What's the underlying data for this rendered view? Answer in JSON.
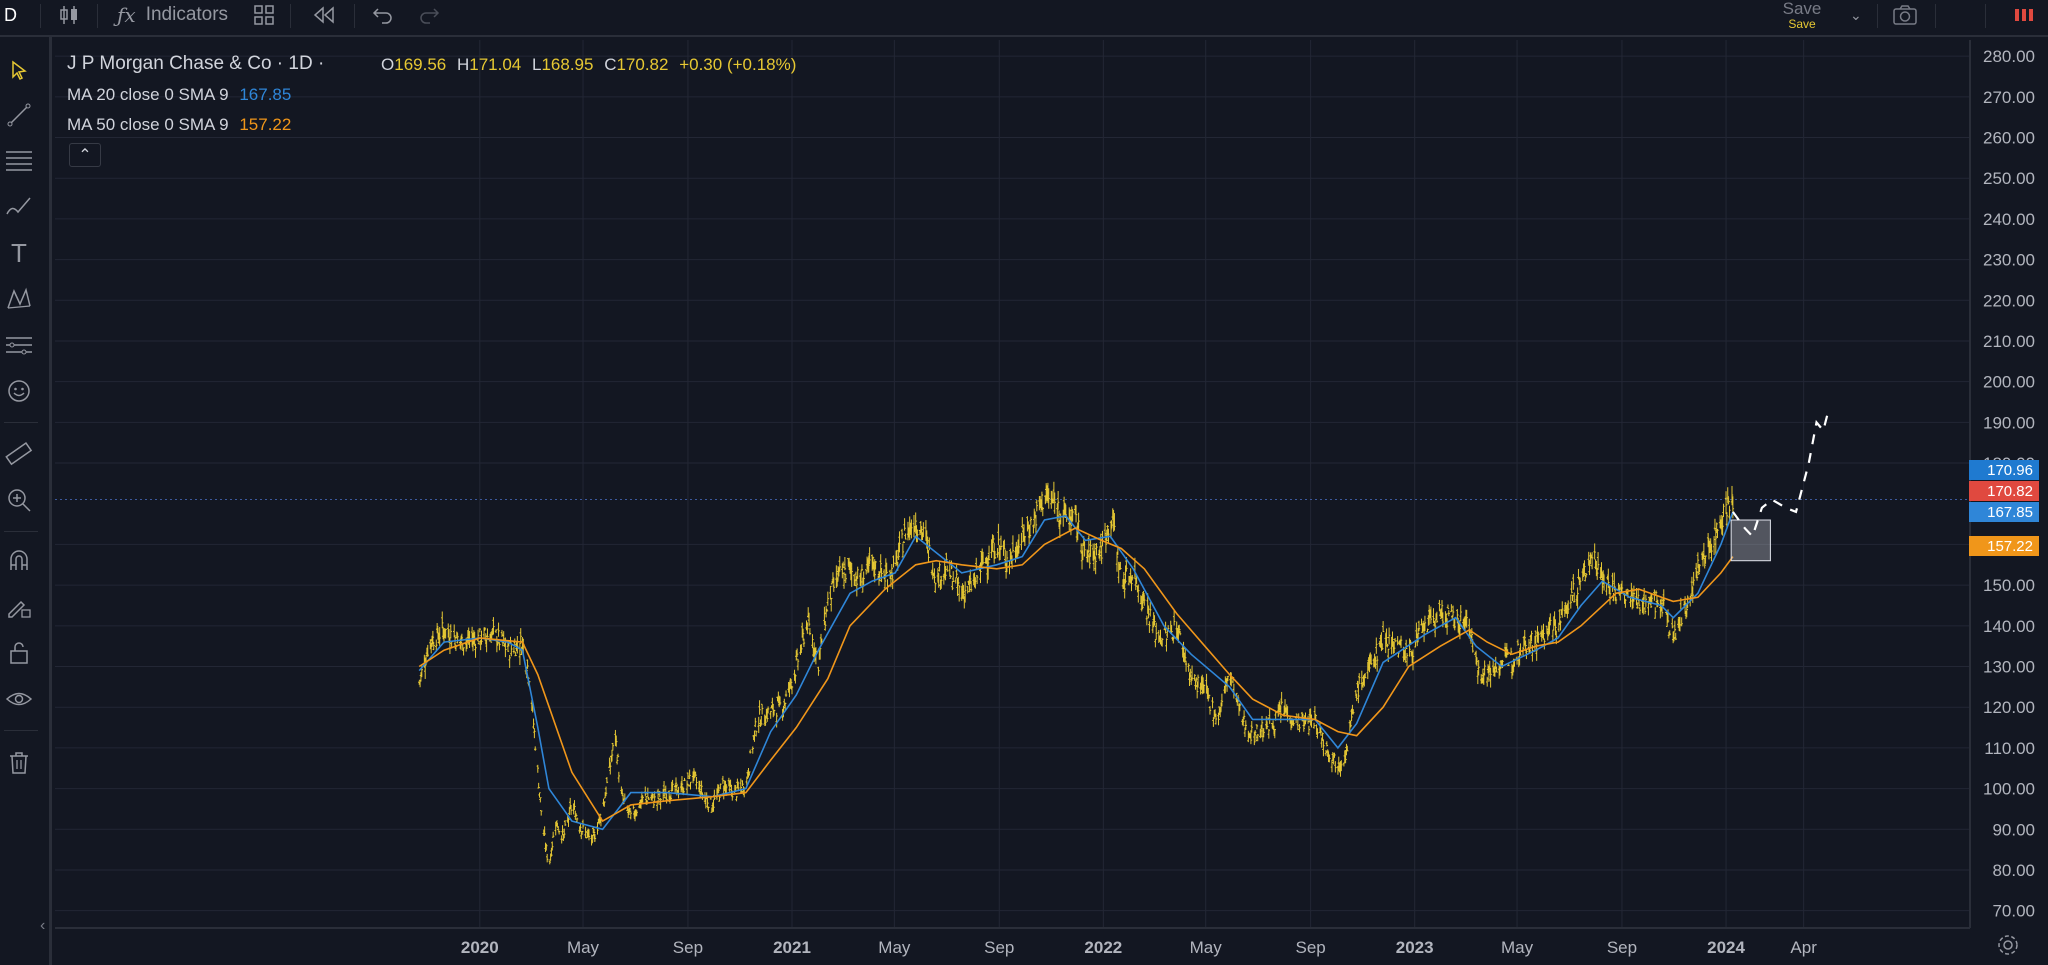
{
  "toolbar": {
    "symbol_letter": "D",
    "indicators_label": "Indicators",
    "save_label": "Save",
    "save_sublabel": "Save"
  },
  "legend": {
    "title": "J P Morgan Chase & Co · 1D ·",
    "open_key": "O",
    "open": "169.56",
    "high_key": "H",
    "high": "171.04",
    "low_key": "L",
    "low": "168.95",
    "close_key": "C",
    "close": "170.82",
    "change": "+0.30 (+0.18%)",
    "ma1_label": "MA 20 close 0 SMA 9",
    "ma1_value": "167.85",
    "ma2_label": "MA 50 close 0 SMA 9",
    "ma2_value": "157.22",
    "collapse_glyph": "⌃"
  },
  "price_tags": {
    "high_tag": "170.96",
    "close_tag": "170.82",
    "ma1_tag": "167.85",
    "ma2_tag": "157.22"
  },
  "colors": {
    "background": "#131722",
    "candles": "#e6c833",
    "ma1": "#2f86d8",
    "ma2": "#f0961a",
    "close_tag": "#e0493f",
    "high_tag": "#1f7ad0"
  },
  "chart_data": {
    "type": "line",
    "title": "J P Morgan Chase & Co · 1D ·",
    "xlabel": "",
    "ylabel": "",
    "ylim": [
      65,
      282
    ],
    "y_ticks": [
      "280.00",
      "270.00",
      "260.00",
      "250.00",
      "240.00",
      "230.00",
      "220.00",
      "210.00",
      "200.00",
      "190.00",
      "180.00",
      "160.00",
      "150.00",
      "140.00",
      "130.00",
      "120.00",
      "110.00",
      "100.00",
      "90.00",
      "80.00",
      "70.00"
    ],
    "x_ticks": [
      {
        "label": "2020",
        "date": "2020-01-01",
        "bold": true
      },
      {
        "label": "May",
        "date": "2020-05-01",
        "bold": false
      },
      {
        "label": "Sep",
        "date": "2020-09-01",
        "bold": false
      },
      {
        "label": "2021",
        "date": "2021-01-01",
        "bold": true
      },
      {
        "label": "May",
        "date": "2021-05-01",
        "bold": false
      },
      {
        "label": "Sep",
        "date": "2021-09-01",
        "bold": false
      },
      {
        "label": "2022",
        "date": "2022-01-01",
        "bold": true
      },
      {
        "label": "May",
        "date": "2022-05-01",
        "bold": false
      },
      {
        "label": "Sep",
        "date": "2022-09-01",
        "bold": false
      },
      {
        "label": "2023",
        "date": "2023-01-01",
        "bold": true
      },
      {
        "label": "May",
        "date": "2023-05-01",
        "bold": false
      },
      {
        "label": "Sep",
        "date": "2023-09-01",
        "bold": false
      },
      {
        "label": "2024",
        "date": "2024-01-01",
        "bold": true
      },
      {
        "label": "Apr",
        "date": "2024-04-01",
        "bold": false
      }
    ],
    "x_range": [
      "2018-08-21",
      "2024-10-13"
    ],
    "series": [
      {
        "name": "Price",
        "kind": "candles",
        "points": [
          [
            "2019-10-22",
            126
          ],
          [
            "2019-11-03",
            136
          ],
          [
            "2019-11-20",
            139
          ],
          [
            "2019-12-11",
            136
          ],
          [
            "2020-01-01",
            137
          ],
          [
            "2020-01-18",
            138
          ],
          [
            "2020-02-03",
            134
          ],
          [
            "2020-02-20",
            136
          ],
          [
            "2020-02-28",
            128
          ],
          [
            "2020-03-09",
            104
          ],
          [
            "2020-03-15",
            90
          ],
          [
            "2020-03-22",
            81
          ],
          [
            "2020-03-30",
            92
          ],
          [
            "2020-04-08",
            88
          ],
          [
            "2020-04-18",
            96
          ],
          [
            "2020-04-30",
            90
          ],
          [
            "2020-05-12",
            87
          ],
          [
            "2020-05-24",
            95
          ],
          [
            "2020-06-08",
            113
          ],
          [
            "2020-06-15",
            98
          ],
          [
            "2020-06-26",
            93
          ],
          [
            "2020-07-13",
            98
          ],
          [
            "2020-07-26",
            97
          ],
          [
            "2020-08-07",
            99
          ],
          [
            "2020-08-25",
            100
          ],
          [
            "2020-09-07",
            103
          ],
          [
            "2020-09-20",
            98
          ],
          [
            "2020-09-30",
            96
          ],
          [
            "2020-10-12",
            101
          ],
          [
            "2020-10-26",
            99
          ],
          [
            "2020-11-08",
            101
          ],
          [
            "2020-11-21",
            117
          ],
          [
            "2020-12-07",
            119
          ],
          [
            "2020-12-23",
            121
          ],
          [
            "2021-01-06",
            130
          ],
          [
            "2021-01-19",
            141
          ],
          [
            "2021-02-01",
            131
          ],
          [
            "2021-02-12",
            146
          ],
          [
            "2021-02-24",
            152
          ],
          [
            "2021-03-10",
            154
          ],
          [
            "2021-03-21",
            151
          ],
          [
            "2021-04-05",
            155
          ],
          [
            "2021-04-20",
            152
          ],
          [
            "2021-05-02",
            154
          ],
          [
            "2021-05-14",
            163
          ],
          [
            "2021-05-26",
            166
          ],
          [
            "2021-06-07",
            161
          ],
          [
            "2021-06-19",
            152
          ],
          [
            "2021-07-02",
            154
          ],
          [
            "2021-07-19",
            148
          ],
          [
            "2021-08-01",
            150
          ],
          [
            "2021-08-14",
            156
          ],
          [
            "2021-08-29",
            160
          ],
          [
            "2021-09-13",
            156
          ],
          [
            "2021-09-28",
            162
          ],
          [
            "2021-10-12",
            166
          ],
          [
            "2021-10-24",
            172
          ],
          [
            "2021-11-05",
            170
          ],
          [
            "2021-11-18",
            167
          ],
          [
            "2021-11-29",
            166
          ],
          [
            "2021-12-11",
            157
          ],
          [
            "2021-12-30",
            159
          ],
          [
            "2022-01-09",
            166
          ],
          [
            "2022-01-13",
            165
          ],
          [
            "2022-01-22",
            151
          ],
          [
            "2022-02-05",
            153
          ],
          [
            "2022-02-18",
            146
          ],
          [
            "2022-03-04",
            138
          ],
          [
            "2022-03-13",
            137
          ],
          [
            "2022-03-28",
            140
          ],
          [
            "2022-04-14",
            127
          ],
          [
            "2022-04-30",
            124
          ],
          [
            "2022-05-15",
            117
          ],
          [
            "2022-05-29",
            129
          ],
          [
            "2022-06-12",
            117
          ],
          [
            "2022-06-25",
            113
          ],
          [
            "2022-07-08",
            115
          ],
          [
            "2022-07-20",
            116
          ],
          [
            "2022-07-31",
            120
          ],
          [
            "2022-08-11",
            117
          ],
          [
            "2022-08-25",
            116
          ],
          [
            "2022-09-06",
            117
          ],
          [
            "2022-09-20",
            110
          ],
          [
            "2022-10-03",
            106
          ],
          [
            "2022-10-13",
            109
          ],
          [
            "2022-10-25",
            124
          ],
          [
            "2022-11-10",
            130
          ],
          [
            "2022-11-25",
            137
          ],
          [
            "2022-12-08",
            136
          ],
          [
            "2022-12-25",
            133
          ],
          [
            "2023-01-14",
            140
          ],
          [
            "2023-01-31",
            143
          ],
          [
            "2023-02-18",
            141
          ],
          [
            "2023-03-06",
            141
          ],
          [
            "2023-03-14",
            130
          ],
          [
            "2023-03-27",
            128
          ],
          [
            "2023-04-13",
            131
          ],
          [
            "2023-04-25",
            132
          ],
          [
            "2023-05-09",
            136
          ],
          [
            "2023-05-23",
            136
          ],
          [
            "2023-06-07",
            139
          ],
          [
            "2023-06-18",
            140
          ],
          [
            "2023-07-01",
            146
          ],
          [
            "2023-07-15",
            151
          ],
          [
            "2023-07-29",
            158
          ],
          [
            "2023-08-09",
            152
          ],
          [
            "2023-08-25",
            148
          ],
          [
            "2023-09-10",
            147
          ],
          [
            "2023-09-21",
            146
          ],
          [
            "2023-10-03",
            146
          ],
          [
            "2023-10-17",
            146
          ],
          [
            "2023-10-31",
            137
          ],
          [
            "2023-11-15",
            145
          ],
          [
            "2023-11-29",
            154
          ],
          [
            "2023-12-14",
            160
          ],
          [
            "2023-12-26",
            166
          ],
          [
            "2024-01-05",
            171
          ],
          [
            "2024-01-09",
            169
          ]
        ]
      },
      {
        "name": "MA 20 close 0 SMA 9",
        "kind": "line",
        "points": [
          [
            "2019-10-22",
            129
          ],
          [
            "2019-11-20",
            136
          ],
          [
            "2020-01-01",
            137
          ],
          [
            "2020-02-03",
            136
          ],
          [
            "2020-02-20",
            134
          ],
          [
            "2020-03-09",
            115
          ],
          [
            "2020-03-22",
            100
          ],
          [
            "2020-04-18",
            92
          ],
          [
            "2020-05-24",
            90
          ],
          [
            "2020-06-26",
            99
          ],
          [
            "2020-08-07",
            99
          ],
          [
            "2020-09-30",
            98
          ],
          [
            "2020-11-08",
            100
          ],
          [
            "2020-12-07",
            114
          ],
          [
            "2021-01-06",
            123
          ],
          [
            "2021-02-01",
            134
          ],
          [
            "2021-03-10",
            148
          ],
          [
            "2021-04-05",
            151
          ],
          [
            "2021-05-02",
            153
          ],
          [
            "2021-05-26",
            162
          ],
          [
            "2021-06-19",
            158
          ],
          [
            "2021-07-19",
            153
          ],
          [
            "2021-08-29",
            155
          ],
          [
            "2021-09-28",
            157
          ],
          [
            "2021-10-24",
            166
          ],
          [
            "2021-11-18",
            167
          ],
          [
            "2021-12-11",
            161
          ],
          [
            "2022-01-09",
            162
          ],
          [
            "2022-02-05",
            154
          ],
          [
            "2022-03-13",
            140
          ],
          [
            "2022-04-14",
            133
          ],
          [
            "2022-05-29",
            125
          ],
          [
            "2022-06-25",
            117
          ],
          [
            "2022-07-31",
            117
          ],
          [
            "2022-09-06",
            117
          ],
          [
            "2022-10-03",
            110
          ],
          [
            "2022-10-25",
            116
          ],
          [
            "2022-11-25",
            131
          ],
          [
            "2023-01-14",
            138
          ],
          [
            "2023-02-18",
            142
          ],
          [
            "2023-03-14",
            135
          ],
          [
            "2023-04-13",
            130
          ],
          [
            "2023-05-23",
            134
          ],
          [
            "2023-06-18",
            137
          ],
          [
            "2023-07-15",
            145
          ],
          [
            "2023-08-09",
            151
          ],
          [
            "2023-09-10",
            147
          ],
          [
            "2023-10-17",
            145
          ],
          [
            "2023-10-31",
            142
          ],
          [
            "2023-11-29",
            148
          ],
          [
            "2023-12-26",
            160
          ],
          [
            "2024-01-09",
            168
          ]
        ]
      },
      {
        "name": "MA 50 close 0 SMA 9",
        "kind": "line",
        "points": [
          [
            "2019-10-22",
            130
          ],
          [
            "2019-11-20",
            134
          ],
          [
            "2020-01-01",
            137
          ],
          [
            "2020-02-20",
            136
          ],
          [
            "2020-03-09",
            128
          ],
          [
            "2020-04-18",
            104
          ],
          [
            "2020-05-24",
            92
          ],
          [
            "2020-06-26",
            96
          ],
          [
            "2020-08-07",
            97
          ],
          [
            "2020-09-30",
            98
          ],
          [
            "2020-11-08",
            99
          ],
          [
            "2020-12-07",
            107
          ],
          [
            "2021-01-06",
            115
          ],
          [
            "2021-02-12",
            127
          ],
          [
            "2021-03-10",
            140
          ],
          [
            "2021-04-20",
            149
          ],
          [
            "2021-05-26",
            155
          ],
          [
            "2021-06-19",
            156
          ],
          [
            "2021-07-19",
            155
          ],
          [
            "2021-08-29",
            154
          ],
          [
            "2021-09-28",
            155
          ],
          [
            "2021-10-24",
            160
          ],
          [
            "2021-11-29",
            164
          ],
          [
            "2021-12-30",
            161
          ],
          [
            "2022-01-22",
            159
          ],
          [
            "2022-02-18",
            154
          ],
          [
            "2022-03-28",
            143
          ],
          [
            "2022-04-30",
            135
          ],
          [
            "2022-05-29",
            128
          ],
          [
            "2022-06-25",
            122
          ],
          [
            "2022-07-31",
            118
          ],
          [
            "2022-09-06",
            117
          ],
          [
            "2022-10-03",
            114
          ],
          [
            "2022-10-25",
            113
          ],
          [
            "2022-11-25",
            120
          ],
          [
            "2022-12-25",
            130
          ],
          [
            "2023-01-31",
            135
          ],
          [
            "2023-03-06",
            139
          ],
          [
            "2023-03-27",
            136
          ],
          [
            "2023-04-25",
            133
          ],
          [
            "2023-05-23",
            135
          ],
          [
            "2023-06-18",
            136
          ],
          [
            "2023-07-15",
            140
          ],
          [
            "2023-08-25",
            148
          ],
          [
            "2023-09-21",
            149
          ],
          [
            "2023-10-31",
            146
          ],
          [
            "2023-11-29",
            147
          ],
          [
            "2023-12-26",
            153
          ],
          [
            "2024-01-09",
            157
          ]
        ]
      }
    ]
  },
  "drawings": {
    "projection_path": [
      [
        "2024-01-09",
        168
      ],
      [
        "2024-01-23",
        164
      ],
      [
        "2024-02-01",
        162
      ],
      [
        "2024-02-12",
        169
      ],
      [
        "2024-02-24",
        171
      ],
      [
        "2024-03-11",
        169
      ],
      [
        "2024-03-23",
        168
      ],
      [
        "2024-04-07",
        180
      ],
      [
        "2024-04-16",
        190
      ],
      [
        "2024-04-24",
        188
      ],
      [
        "2024-04-29",
        192
      ]
    ],
    "rect": {
      "start": "2024-01-07",
      "end": "2024-02-22",
      "top": 166,
      "bottom": 156
    }
  }
}
